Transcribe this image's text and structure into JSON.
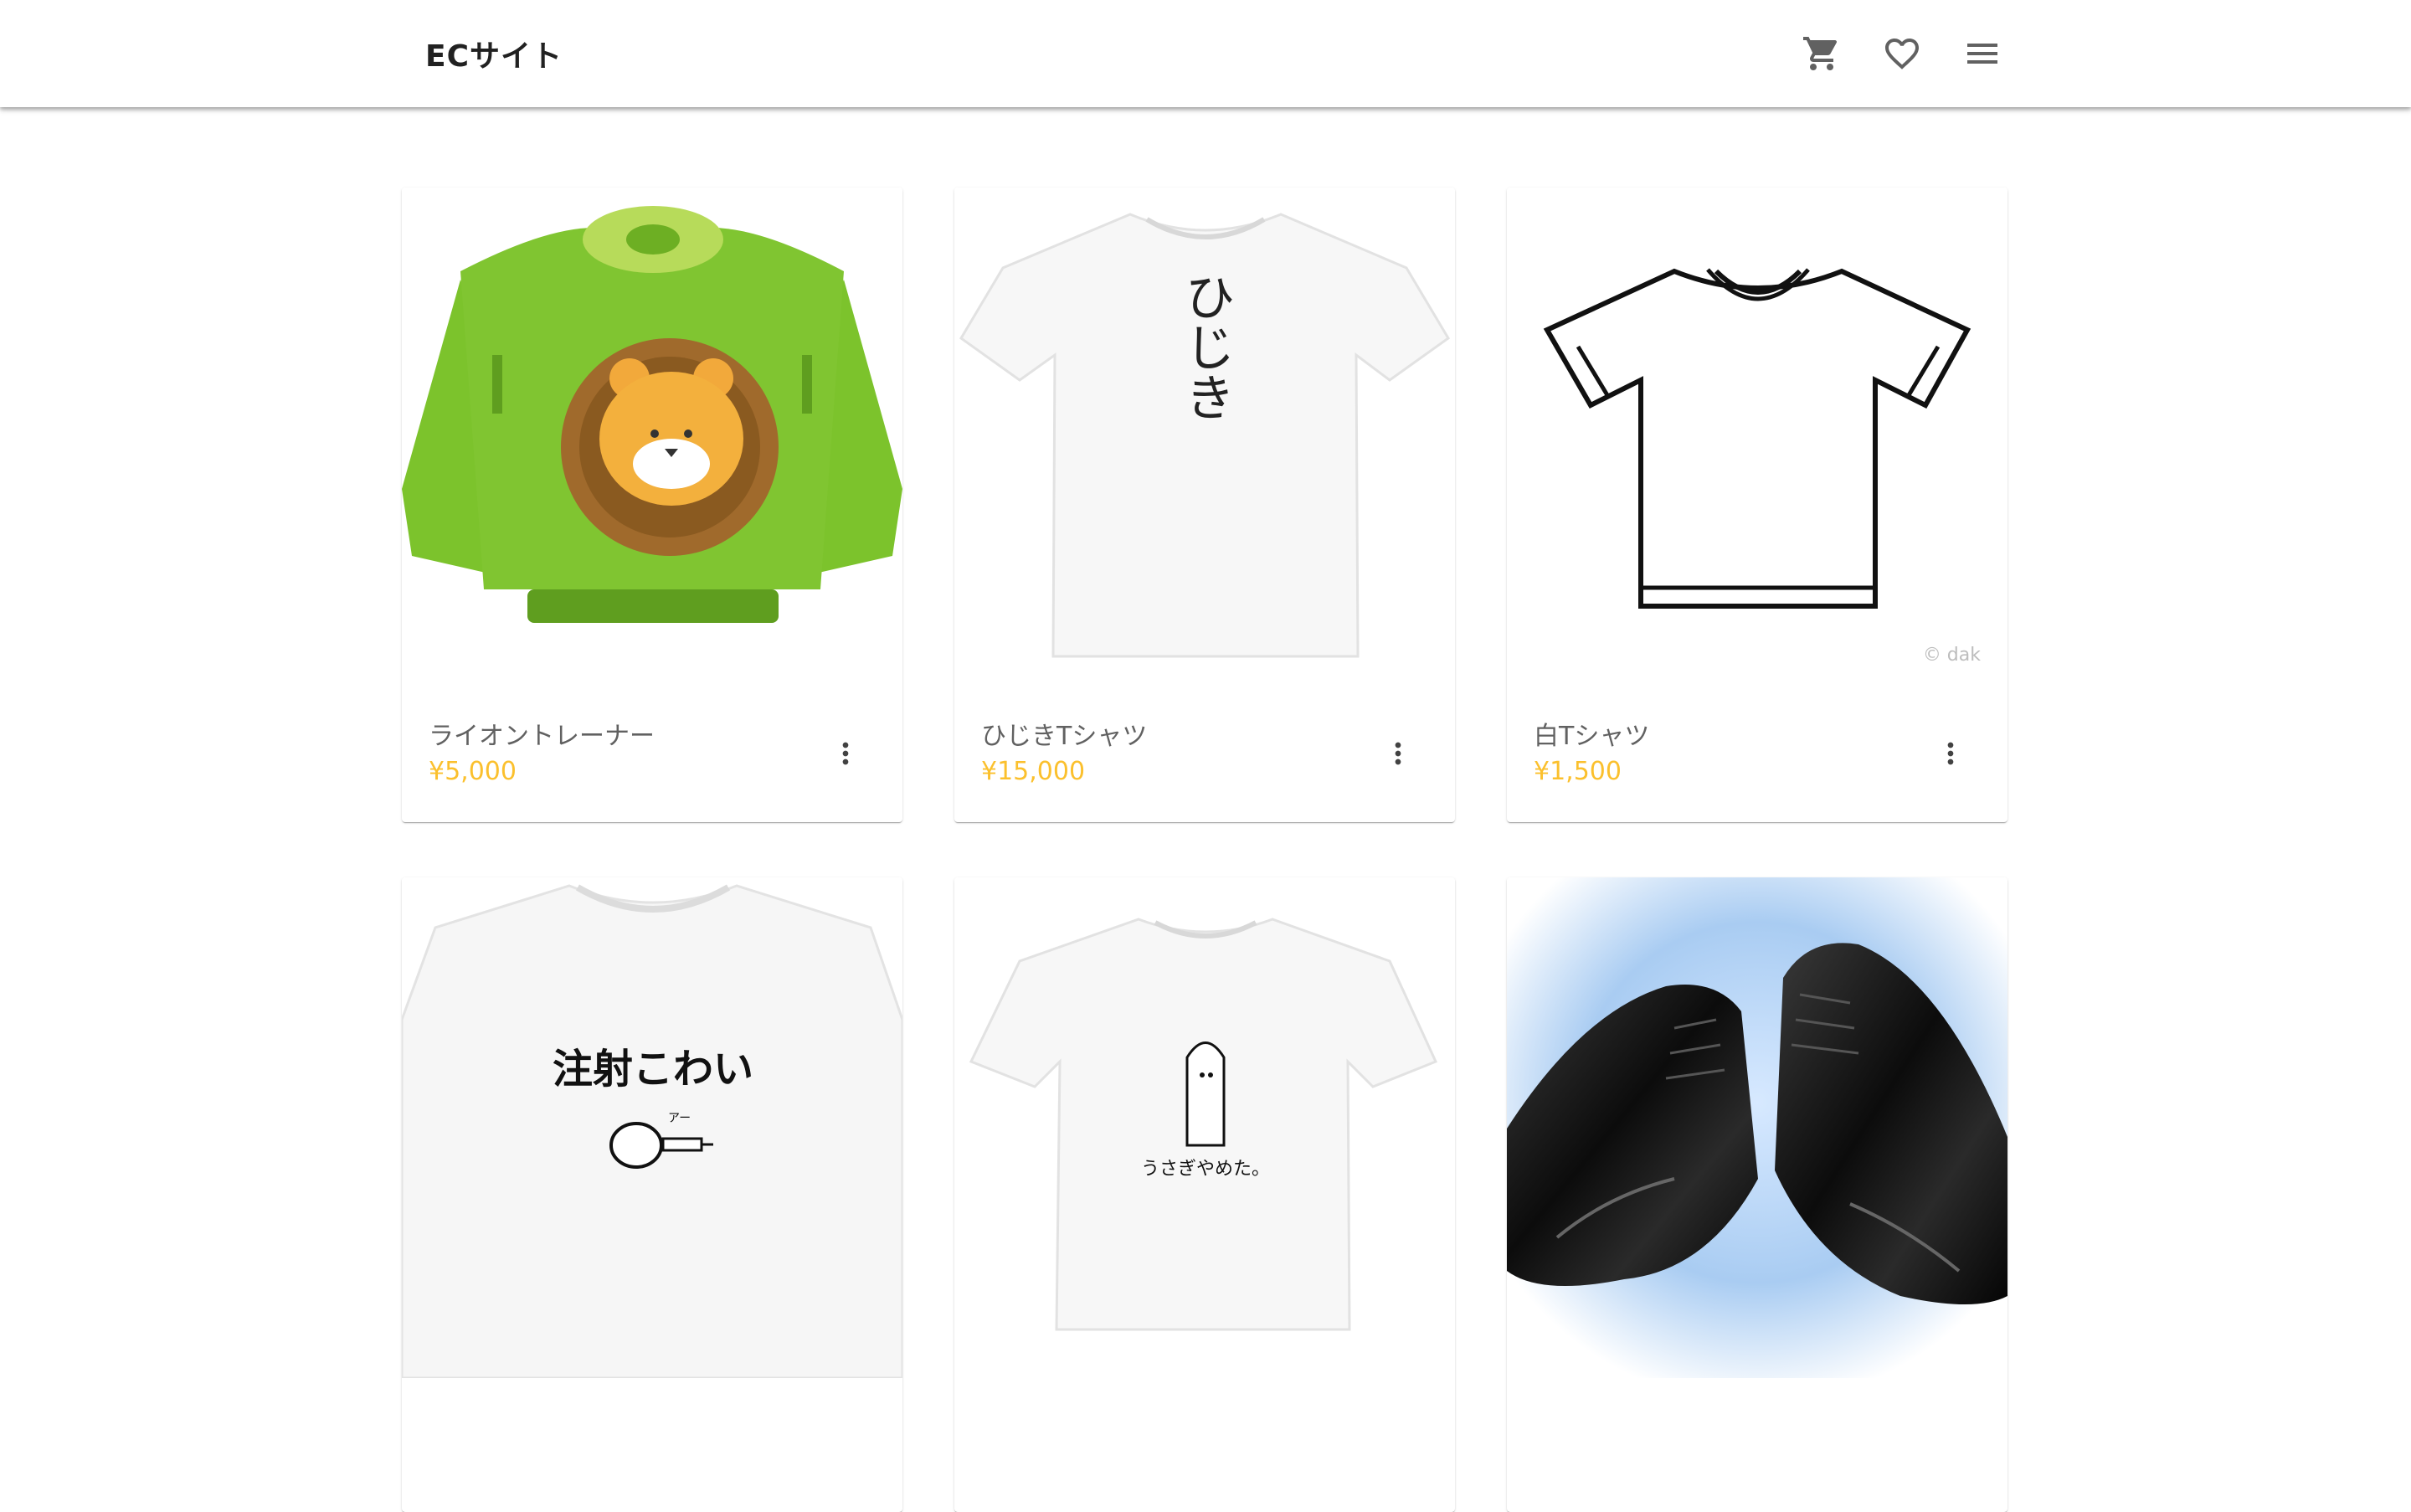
{
  "header": {
    "title": "ECサイト",
    "icons": [
      "cart-icon",
      "favorite-border-icon",
      "menu-icon"
    ]
  },
  "products": [
    {
      "name": "ライオントレーナー",
      "price": "¥5,000",
      "image": "lion-sweater"
    },
    {
      "name": "ひじきTシャツ",
      "price": "¥15,000",
      "image": "hijiki-tshirt",
      "print_text": "ひじき"
    },
    {
      "name": "白Tシャツ",
      "price": "¥1,500",
      "image": "white-tshirt-outline",
      "watermark": "© dak"
    },
    {
      "name": "",
      "price": "",
      "image": "chusha-kowai-tshirt",
      "print_text": "注射こわい",
      "print_small": "アー"
    },
    {
      "name": "",
      "price": "",
      "image": "usagi-yameta-tshirt",
      "print_text": "うさぎやめた。"
    },
    {
      "name": "",
      "price": "",
      "image": "black-leather-shoes"
    }
  ],
  "colors": {
    "price": "#fbc02d",
    "title": "#212121",
    "product_name": "#616161",
    "icon": "#616161"
  }
}
